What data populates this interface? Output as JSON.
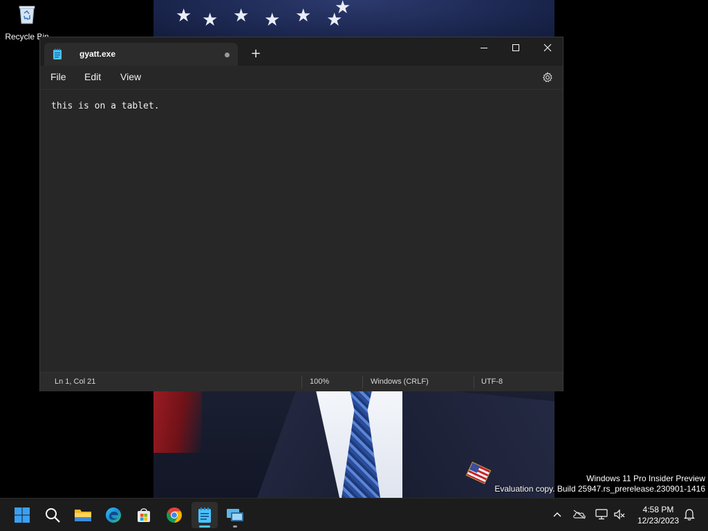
{
  "desktop": {
    "icons": [
      {
        "label": "Recycle Bin",
        "icon": "recycle-bin-icon"
      }
    ]
  },
  "notepad": {
    "tab_title": "gyatt.exe",
    "unsaved_indicator": "dot",
    "new_tab_symbol": "+",
    "menu": {
      "file": "File",
      "edit": "Edit",
      "view": "View"
    },
    "content": "this is on a tablet.",
    "status": {
      "position": "Ln 1, Col 21",
      "zoom": "100%",
      "line_ending": "Windows (CRLF)",
      "encoding": "UTF-8"
    }
  },
  "watermark": {
    "line1": "Windows 11 Pro Insider Preview",
    "line2": "Evaluation copy. Build 25947.rs_prerelease.230901-1416"
  },
  "taskbar": {
    "apps": [
      "start-icon",
      "search-icon",
      "file-explorer-icon",
      "edge-icon",
      "store-icon",
      "chrome-icon",
      "notepad-icon",
      "remote-desktop-icon"
    ],
    "active_app": "notepad-icon",
    "tray": [
      "chevron-up-icon",
      "onedrive-icon",
      "network-icon",
      "volume-icon"
    ],
    "time": "4:58 PM",
    "date": "12/23/2023"
  },
  "colors": {
    "window_bg": "#272727",
    "titlebar_bg": "#1f1f1f",
    "taskbar_bg": "#1c1c1c",
    "accent": "#4cc2ff"
  }
}
